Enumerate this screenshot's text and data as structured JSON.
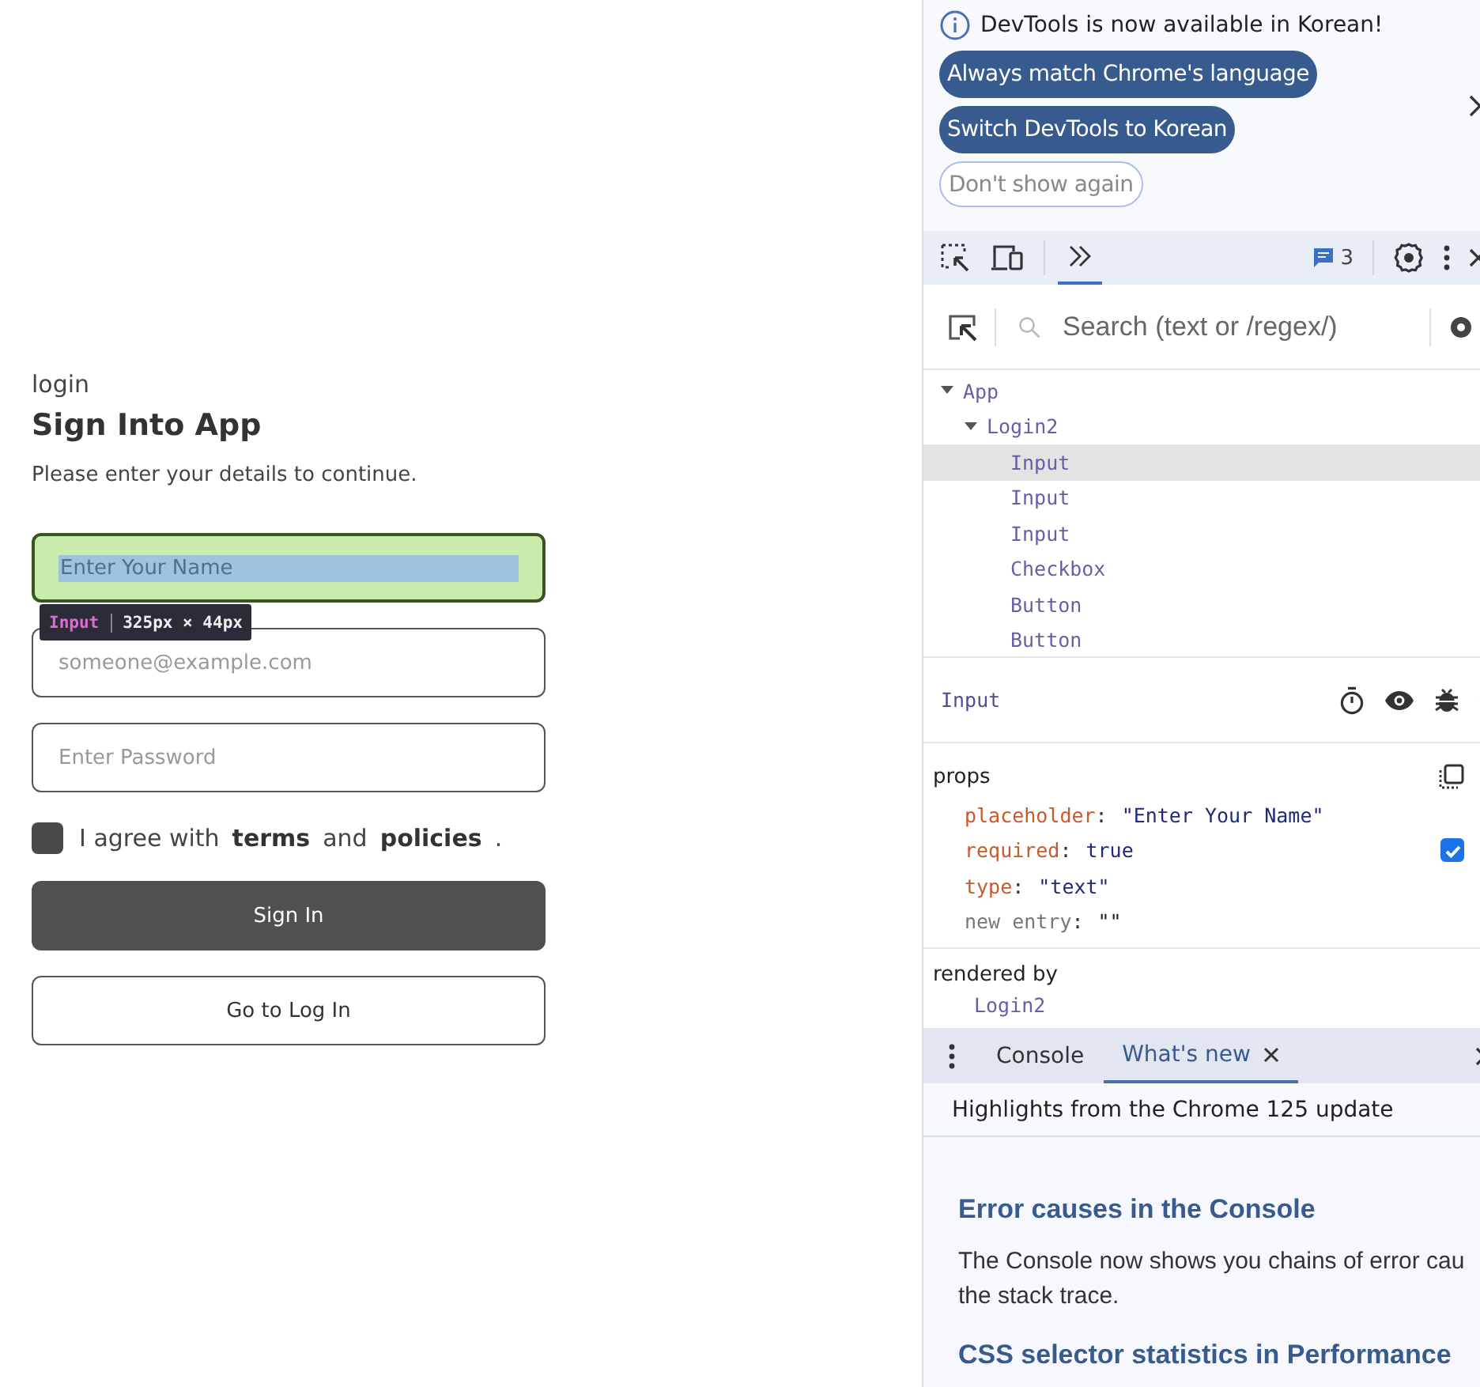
{
  "app": {
    "page_label": "login",
    "title": "Sign Into App",
    "subtitle": "Please enter your details to continue.",
    "fields": [
      {
        "placeholder": "Enter Your Name",
        "highlighted": true
      },
      {
        "placeholder": "someone@example.com",
        "highlighted": false
      },
      {
        "placeholder": "Enter Password",
        "highlighted": false
      }
    ],
    "agreement": {
      "checked": false,
      "parts": [
        {
          "text": "I agree with",
          "bold": false
        },
        {
          "text": "terms",
          "bold": true
        },
        {
          "text": "and",
          "bold": false
        },
        {
          "text": "policies",
          "bold": true
        },
        {
          "text": ".",
          "bold": false
        }
      ]
    },
    "buttons": [
      {
        "label": "Sign In",
        "kind": "primary"
      },
      {
        "label": "Go to Log In",
        "kind": "outline"
      }
    ],
    "inspect_tooltip": {
      "component": "Input",
      "size": "325px × 44px"
    }
  },
  "devtools": {
    "banner": {
      "message": "DevTools is now available in Korean!",
      "actions": [
        {
          "label": "Always match Chrome's language",
          "kind": "primary"
        },
        {
          "label": "Switch DevTools to Korean",
          "kind": "primary"
        },
        {
          "label": "Don't show again",
          "kind": "secondary"
        }
      ]
    },
    "toolbar": {
      "issues_count": "3"
    },
    "search": {
      "placeholder": "Search (text or /regex/)"
    },
    "tree": [
      {
        "label": "App",
        "expanded": true,
        "selected": false,
        "children": [
          {
            "label": "Login2",
            "expanded": true,
            "selected": false,
            "children": [
              {
                "label": "Input",
                "selected": true
              },
              {
                "label": "Input",
                "selected": false
              },
              {
                "label": "Input",
                "selected": false
              },
              {
                "label": "Checkbox",
                "selected": false
              },
              {
                "label": "Button",
                "selected": false
              },
              {
                "label": "Button",
                "selected": false
              }
            ]
          }
        ]
      }
    ],
    "details": {
      "component": "Input",
      "props_title": "props",
      "props": [
        {
          "key": "placeholder",
          "separator": ":",
          "value": "\"Enter Your Name\"",
          "kind": "string"
        },
        {
          "key": "required",
          "separator": ":",
          "value": "true",
          "kind": "boolean",
          "checked": true
        },
        {
          "key": "type",
          "separator": ":",
          "value": "\"text\"",
          "kind": "string"
        },
        {
          "key": "new entry",
          "separator": ":",
          "value": "\"\"",
          "kind": "new"
        }
      ],
      "rendered_by_title": "rendered by",
      "rendered_by": "Login2"
    },
    "drawer": {
      "tabs": [
        {
          "label": "Console",
          "selected": false,
          "closable": false
        },
        {
          "label": "What's new",
          "selected": true,
          "closable": true
        }
      ],
      "header": "Highlights from the Chrome 125 update",
      "sections": [
        {
          "heading": "Error causes in the Console",
          "body": "The Console now shows you chains of error cau\nthe stack trace."
        },
        {
          "heading": "CSS selector statistics in Performance"
        }
      ]
    }
  }
}
